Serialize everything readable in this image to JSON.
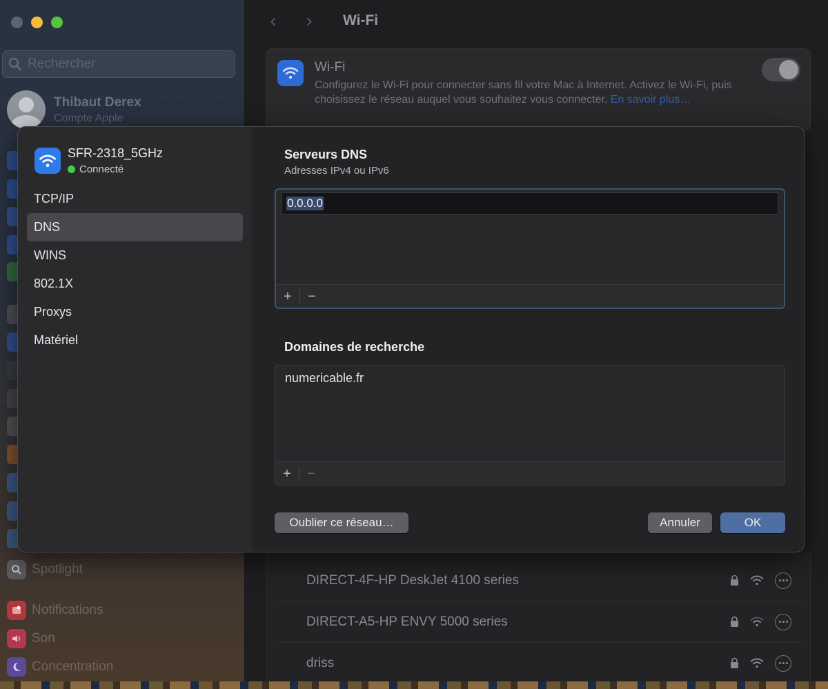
{
  "sidebar": {
    "search_placeholder": "Rechercher",
    "account_name": "Thibaut Derex",
    "account_sub": "Compte Apple",
    "items": [
      {
        "label": "Spotlight",
        "icon": "magnifier-icon"
      },
      {
        "label": "Notifications",
        "icon": "bell-icon"
      },
      {
        "label": "Son",
        "icon": "speaker-icon"
      },
      {
        "label": "Concentration",
        "icon": "moon-icon"
      }
    ]
  },
  "header": {
    "title": "Wi-Fi"
  },
  "wifi_card": {
    "title": "Wi-Fi",
    "description": "Configurez le Wi-Fi pour connecter sans fil votre Mac à Internet. Activez le Wi-Fi, puis choisissez le réseau auquel vous souhaitez vous connecter.",
    "link": "En savoir plus…",
    "toggle_on": true
  },
  "networks": [
    {
      "name": "DIRECT-4F-HP DeskJet 4100 series",
      "locked": true
    },
    {
      "name": "DIRECT-A5-HP ENVY 5000 series",
      "locked": true
    },
    {
      "name": "driss",
      "locked": true
    }
  ],
  "modal": {
    "network_name": "SFR-2318_5GHz",
    "status": "Connecté",
    "status_color": "#3ecf4a",
    "nav": [
      {
        "label": "TCP/IP",
        "active": false
      },
      {
        "label": "DNS",
        "active": true
      },
      {
        "label": "WINS",
        "active": false
      },
      {
        "label": "802.1X",
        "active": false
      },
      {
        "label": "Proxys",
        "active": false
      },
      {
        "label": "Matériel",
        "active": false
      }
    ],
    "dns": {
      "title": "Serveurs DNS",
      "subtitle": "Adresses IPv4 ou IPv6",
      "servers": [
        "0.0.0.0"
      ],
      "add": "+",
      "remove": "−"
    },
    "search_domains": {
      "title": "Domaines de recherche",
      "domains": [
        "numericable.fr"
      ],
      "add": "+",
      "remove": "−"
    },
    "buttons": {
      "forget": "Oublier ce réseau…",
      "cancel": "Annuler",
      "ok": "OK"
    },
    "accent": "#4f6fa3"
  }
}
